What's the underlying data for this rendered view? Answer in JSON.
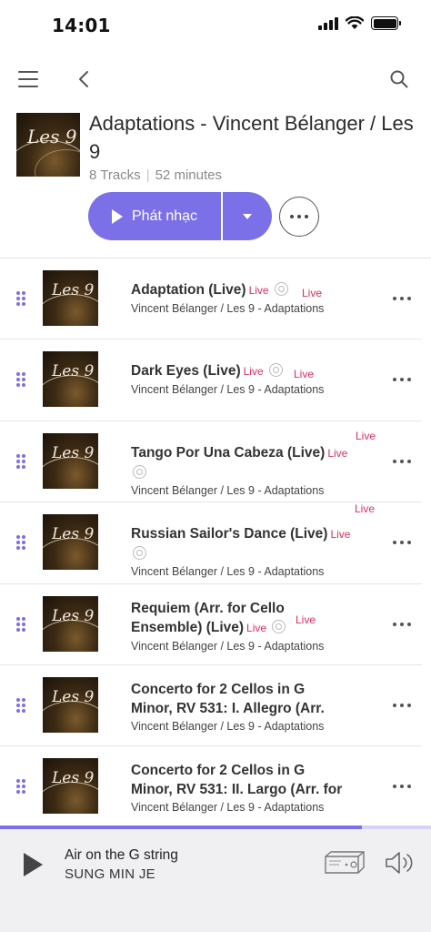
{
  "status_bar": {
    "time": "14:01"
  },
  "nav": {
    "menu_icon": "hamburger-menu-icon",
    "back_icon": "chevron-left-icon",
    "search_icon": "search-icon"
  },
  "album": {
    "title": "Adaptations - Vincent Bélanger / Les 9",
    "tracks_count": "8 Tracks",
    "separator": "|",
    "duration": "52 minutes",
    "play_label": "Phát nhạc",
    "art_text": "Les 9"
  },
  "colors": {
    "accent": "#7b70e8",
    "live": "#d8315b",
    "player_bg": "#f0f0f2"
  },
  "tracks": [
    {
      "title": "Adaptation (Live)",
      "live_inline": "Live",
      "live_side": "Live",
      "subtitle": "Vincent Bélanger / Les 9 - Adaptations"
    },
    {
      "title": "Dark Eyes (Live)",
      "live_inline": "Live",
      "live_side": "Live",
      "subtitle": "Vincent Bélanger / Les 9 - Adaptations"
    },
    {
      "title": "Tango Por Una Cabeza (Live)",
      "live_inline": "Live",
      "live_side": "Live",
      "subtitle": "Vincent Bélanger / Les 9 - Adaptations"
    },
    {
      "title": "Russian Sailor's Dance (Live)",
      "live_inline": "Live",
      "live_side": "Live",
      "subtitle": "Vincent Bélanger / Les 9 - Adaptations"
    },
    {
      "title": "Requiem (Arr. for Cello Ensemble) (Live)",
      "live_inline": "Live",
      "live_side": "Live",
      "subtitle": "Vincent Bélanger / Les 9 - Adaptations"
    },
    {
      "title": "Concerto for 2 Cellos in G Minor, RV 531: I. Allegro (Arr.",
      "subtitle": "Vincent Bélanger / Les 9 - Adaptations"
    },
    {
      "title": "Concerto for 2 Cellos in G Minor, RV 531: II. Largo (Arr. for",
      "subtitle": "Vincent Bélanger / Les 9 - Adaptations"
    }
  ],
  "player": {
    "song": "Air on the G string",
    "artist": "SUNG MIN JE",
    "progress": 0.84
  }
}
